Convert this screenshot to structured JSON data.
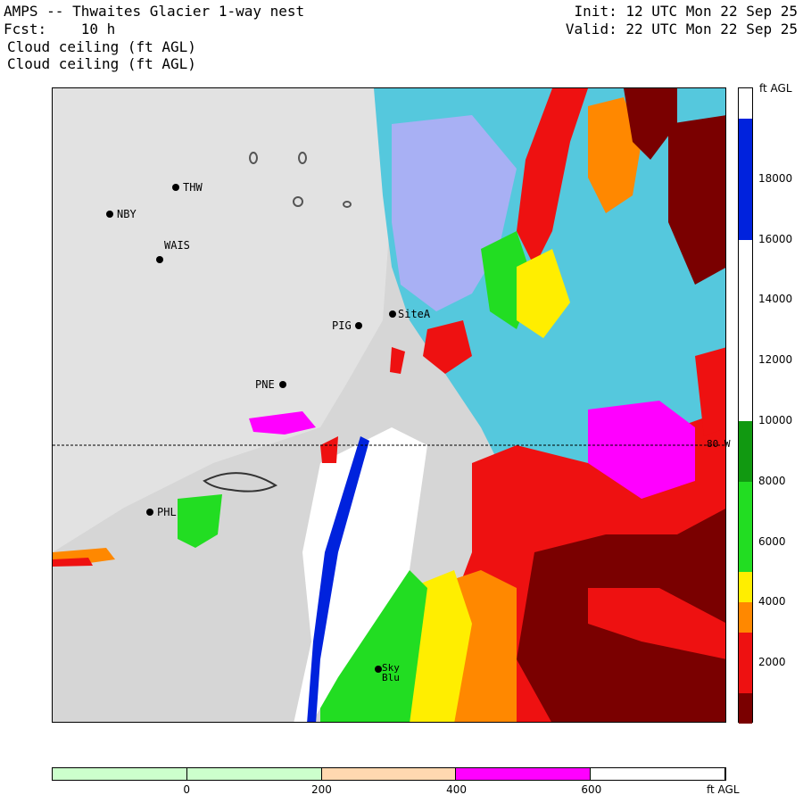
{
  "header": {
    "title": "AMPS -- Thwaites Glacier 1-way nest",
    "fcst": "Fcst:    10 h",
    "variable_line1": "Cloud ceiling (ft AGL)",
    "variable_line2": "Cloud ceiling (ft AGL)",
    "init": "Init: 12 UTC Mon 22 Sep 25",
    "valid": "Valid: 22 UTC Mon 22 Sep 25"
  },
  "map": {
    "latitude_line_label": "80 W",
    "stations": [
      {
        "id": "THW"
      },
      {
        "id": "NBY"
      },
      {
        "id": "WAIS"
      },
      {
        "id": "SiteA"
      },
      {
        "id": "PIG"
      },
      {
        "id": "PNE"
      },
      {
        "id": "PHL"
      },
      {
        "id": "Sky Blu"
      }
    ]
  },
  "colorbar": {
    "unit": "ft AGL",
    "tick_labels": [
      "18000",
      "16000",
      "14000",
      "12000",
      "10000",
      "8000",
      "6000",
      "4000",
      "2000"
    ],
    "bins": [
      {
        "min": 0,
        "max": 1000,
        "color": "#7a0000"
      },
      {
        "min": 1000,
        "max": 3000,
        "color": "#ee1111"
      },
      {
        "min": 3000,
        "max": 4000,
        "color": "#ff8800"
      },
      {
        "min": 4000,
        "max": 5000,
        "color": "#ffee00"
      },
      {
        "min": 5000,
        "max": 8000,
        "color": "#22dd22"
      },
      {
        "min": 8000,
        "max": 10000,
        "color": "#119911"
      },
      {
        "min": 10000,
        "max": 16000,
        "color": "#ffffff"
      },
      {
        "min": 16000,
        "max": 20000,
        "color": "#0022dd"
      },
      {
        "min": 20000,
        "max": 21000,
        "color": "#ffffff"
      }
    ]
  },
  "terrain_bar": {
    "unit": "ft AGL",
    "tick_labels": [
      "0",
      "200",
      "400",
      "600"
    ],
    "colors": [
      "#ccffcc",
      "#ccffcc",
      "#ffd8b0",
      "#ff00ff",
      "#ffffff"
    ]
  },
  "colors": {
    "sea_cyan": "#55c8dd",
    "ice_lavender": "#a8b0f4",
    "terrain_gray": "#d8d8d8",
    "magenta": "#ff00ff"
  }
}
